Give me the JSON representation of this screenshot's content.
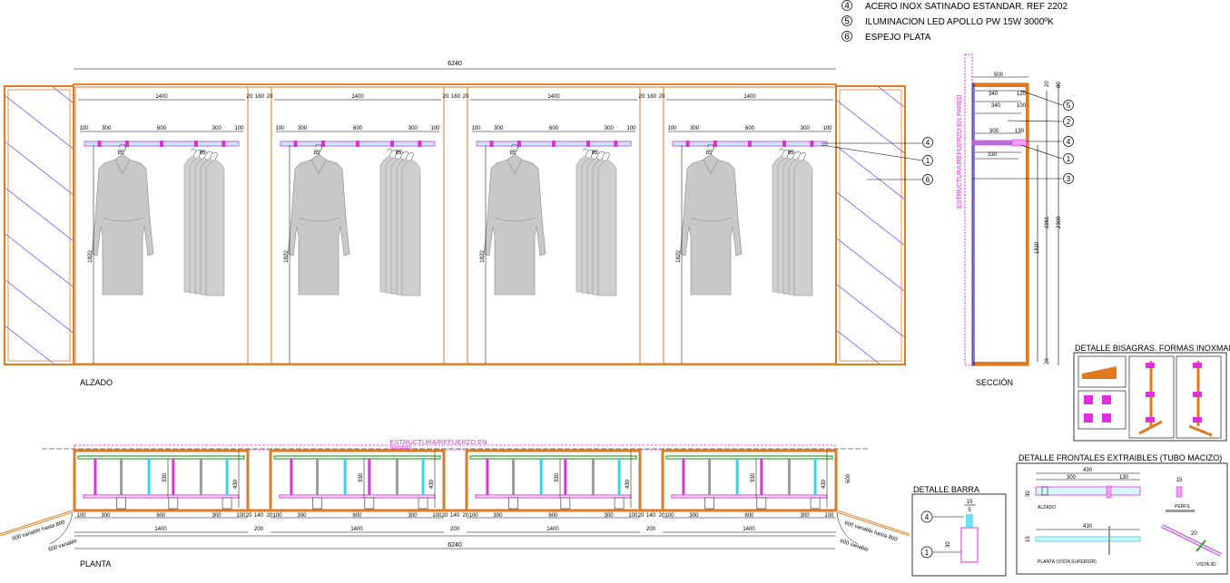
{
  "legend": [
    {
      "num": "4",
      "text": "ACERO INOX SATINADO ESTANDAR. REF 2202"
    },
    {
      "num": "5",
      "text": "ILUMINACION LED APOLLO PW 15W 3000ºK"
    },
    {
      "num": "6",
      "text": "ESPEJO PLATA"
    }
  ],
  "elevation": {
    "label": "ALZADO",
    "total_width": "6240",
    "module_width": "1400",
    "gap_dims": [
      "20",
      "160",
      "20"
    ],
    "rail_dims": [
      "100",
      "300",
      "600",
      "300",
      "100"
    ],
    "small_dims": [
      "85",
      "85"
    ],
    "height_dim": "1820",
    "callouts": [
      "4",
      "1",
      "6"
    ]
  },
  "section": {
    "label": "SECCIÓN",
    "vertical_text": "ESTRUCTURA/REFUERZO EN PARED",
    "dims_top": [
      "500",
      "340",
      "120",
      "340",
      "100",
      "300",
      "130",
      "330"
    ],
    "dims_side": [
      "20",
      "80",
      "2261",
      "2300",
      "1820",
      "20"
    ],
    "callouts": [
      "5",
      "2",
      "4",
      "1",
      "3"
    ]
  },
  "plan": {
    "label": "PLANTA",
    "reinforcement_text": "ESTRUCTURA/REFUERZO EN",
    "reinforcement_text_2": "PARED",
    "module_dims": [
      "100",
      "300",
      "600",
      "300",
      "100"
    ],
    "gap_dims": [
      "20",
      "140",
      "20"
    ],
    "module_width": "1400",
    "gap_width": "200",
    "total_width": "6240",
    "depth_dims": [
      "330",
      "430",
      "500"
    ],
    "left_note": "600 variable hasta 800",
    "left_note_2": "600 variable",
    "right_note": "600 variable hasta 800",
    "right_note_2": "600 variable"
  },
  "detail_hinges": {
    "title": "DETALLE BISAGRAS. FORMAS INOXMAN"
  },
  "detail_bar": {
    "title": "DETALLE BARRA",
    "dims": [
      "15",
      "5",
      "30"
    ],
    "callouts": [
      "4",
      "1"
    ]
  },
  "detail_fronts": {
    "title": "DETALLE FRONTALES EXTRAIBLES (TUBO MACIZO)",
    "dims_top": [
      "430",
      "300",
      "130",
      "30",
      "15"
    ],
    "alzado_label": "ALZADO",
    "perfil_label": "PERFIL",
    "planta_label": "PLANTA (VISTA SUPERIOR)",
    "vista_label": "VISTA 3D",
    "dims_plan": [
      "430",
      "15",
      "20",
      "30"
    ]
  },
  "colors": {
    "orange": "#e07a1f",
    "magenta": "#e02ee0",
    "cyan": "#2ed6f0",
    "blue": "#1a1aff",
    "grey": "#9a9a9a",
    "garment": "#c8c8c8",
    "green": "#2fa02f"
  }
}
